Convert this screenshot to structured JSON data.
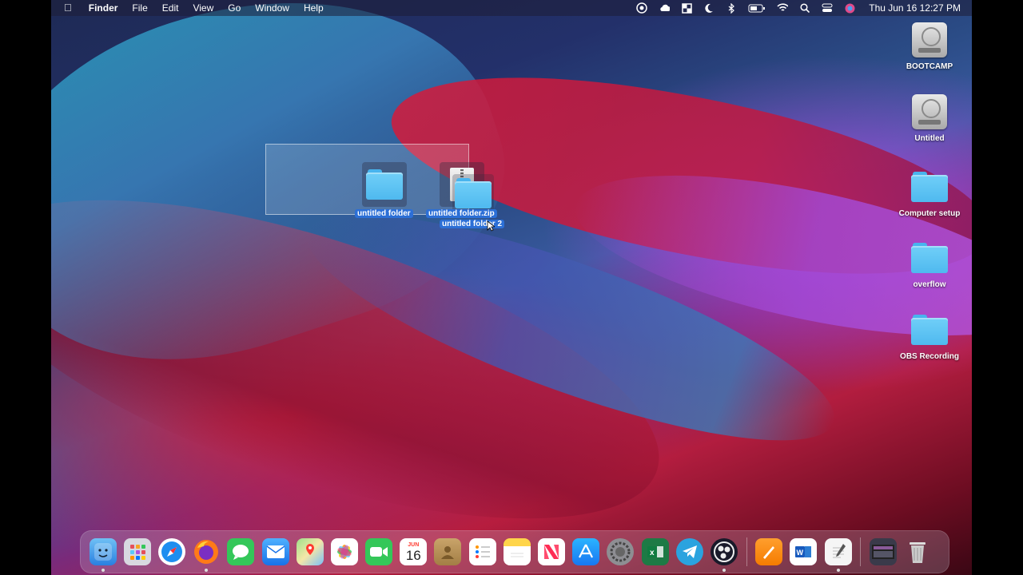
{
  "menubar": {
    "apple": "",
    "app_name": "Finder",
    "menus": [
      "File",
      "Edit",
      "View",
      "Go",
      "Window",
      "Help"
    ],
    "clock": "Thu Jun 16  12:27 PM"
  },
  "desktop_icons": [
    {
      "label": "BOOTCAMP",
      "kind": "drive"
    },
    {
      "label": "Untitled",
      "kind": "drive"
    },
    {
      "label": "Computer setup",
      "kind": "folder"
    },
    {
      "label": "overflow",
      "kind": "folder"
    },
    {
      "label": "OBS Recording",
      "kind": "folder"
    }
  ],
  "selected_items": {
    "folder1": "untitled folder",
    "zip": "untitled folder.zip",
    "folder2": "untitled folder 2"
  },
  "dock": {
    "calendar_month": "JUN",
    "calendar_day": "16",
    "apps": [
      "Finder",
      "Launchpad",
      "Safari",
      "Firefox",
      "Messages",
      "Mail",
      "Maps",
      "Photos",
      "FaceTime",
      "Calendar",
      "Contacts",
      "Reminders",
      "Notes",
      "News",
      "App Store",
      "System Preferences",
      "Excel",
      "Telegram",
      "OBS",
      "Pages",
      "Word",
      "TextEdit",
      "Downloads",
      "Trash"
    ]
  },
  "colors": {
    "folder_blue": "#5bc1f2",
    "selection_label": "#2c6fd6"
  }
}
